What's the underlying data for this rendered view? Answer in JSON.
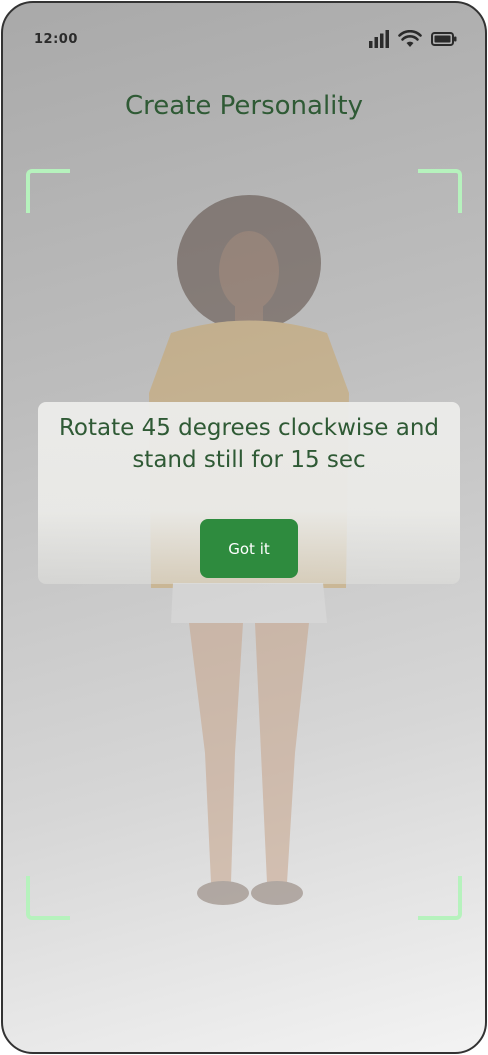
{
  "status_bar": {
    "time": "12:00",
    "icons": [
      "signal-icon",
      "wifi-icon",
      "battery-icon"
    ]
  },
  "header": {
    "title": "Create Personality"
  },
  "scan_frame": {
    "corner_color": "#b6f2bd"
  },
  "dialog": {
    "instruction": "Rotate 45 degrees clockwise and stand still for 15 sec",
    "confirm_label": "Got it",
    "button_color": "#2e8b3e"
  }
}
